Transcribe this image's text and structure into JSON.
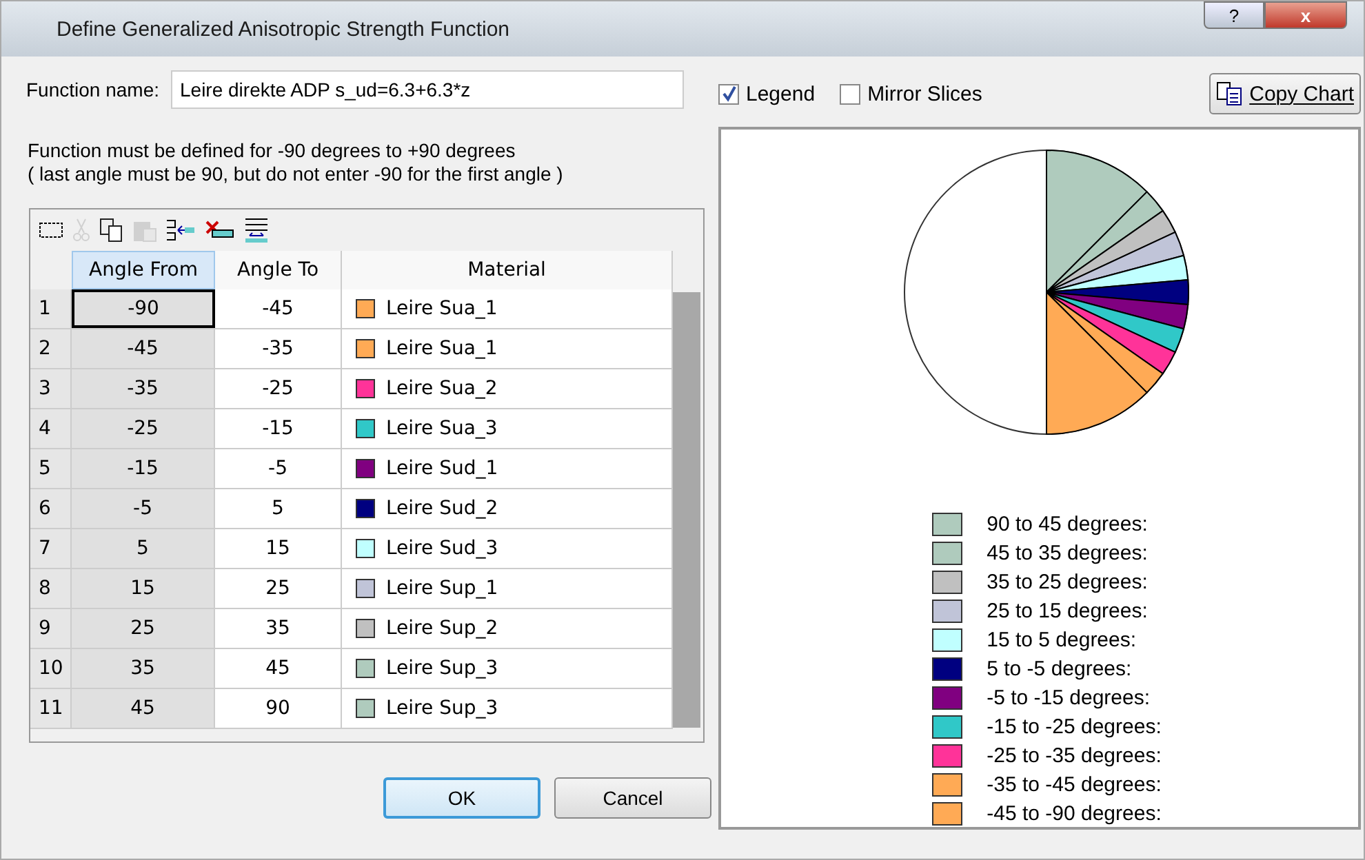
{
  "window": {
    "title": "Define Generalized Anisotropic Strength Function",
    "buttons": [
      "?",
      "x"
    ]
  },
  "function_name": {
    "label": "Function name:",
    "value": "Leire direkte ADP s_ud=6.3+6.3*z"
  },
  "note": [
    "Function must be defined for -90 degrees to +90 degrees",
    "( last angle must be 90, but do not enter -90 for the first angle )"
  ],
  "toolbar": [
    {
      "kind": "select",
      "disabled": false
    },
    {
      "kind": "cut",
      "disabled": true
    },
    {
      "kind": "copy",
      "disabled": false
    },
    {
      "kind": "paste",
      "disabled": true
    },
    {
      "kind": "insert",
      "disabled": false
    },
    {
      "kind": "delete",
      "disabled": false
    },
    {
      "kind": "append",
      "disabled": false
    }
  ],
  "table": {
    "columns": [
      {
        "label": "Angle From",
        "selected": true
      },
      {
        "label": "Angle To",
        "selected": false
      },
      {
        "label": "Material",
        "selected": false
      }
    ],
    "rows": [
      {
        "number": "1",
        "angle_from": "-90",
        "angle_to": "-45",
        "material": "Leire Sua_1",
        "color": "#ffaa55",
        "selected": true
      },
      {
        "number": "2",
        "angle_from": "-45",
        "angle_to": "-35",
        "material": "Leire Sua_1",
        "color": "#ffaa55",
        "selected": false
      },
      {
        "number": "3",
        "angle_from": "-35",
        "angle_to": "-25",
        "material": "Leire Sua_2",
        "color": "#ff3399",
        "selected": false
      },
      {
        "number": "4",
        "angle_from": "-25",
        "angle_to": "-15",
        "material": "Leire Sua_3",
        "color": "#30c8c8",
        "selected": false
      },
      {
        "number": "5",
        "angle_from": "-15",
        "angle_to": "-5",
        "material": "Leire Sud_1",
        "color": "#800080",
        "selected": false
      },
      {
        "number": "6",
        "angle_from": "-5",
        "angle_to": "5",
        "material": "Leire Sud_2",
        "color": "#000080",
        "selected": false
      },
      {
        "number": "7",
        "angle_from": "5",
        "angle_to": "15",
        "material": "Leire Sud_3",
        "color": "#c0ffff",
        "selected": false
      },
      {
        "number": "8",
        "angle_from": "15",
        "angle_to": "25",
        "material": "Leire Sup_1",
        "color": "#c0c4d8",
        "selected": false
      },
      {
        "number": "9",
        "angle_from": "25",
        "angle_to": "35",
        "material": "Leire Sup_2",
        "color": "#c0c0c0",
        "selected": false
      },
      {
        "number": "10",
        "angle_from": "35",
        "angle_to": "45",
        "material": "Leire Sup_3",
        "color": "#afcbbd",
        "selected": false
      },
      {
        "number": "11",
        "angle_from": "45",
        "angle_to": "90",
        "material": "Leire Sup_3",
        "color": "#afcbbd",
        "selected": false
      }
    ]
  },
  "buttons": [
    {
      "label": "OK",
      "default": true
    },
    {
      "label": "Cancel",
      "default": false
    }
  ],
  "options": [
    {
      "label": "Legend",
      "checked": true
    },
    {
      "label": "Mirror Slices",
      "checked": false
    }
  ],
  "copy_button": {
    "label": "Copy Chart"
  },
  "chart": {
    "label_suffix": ":",
    "legend": [
      {
        "color": "#afcbbd"
      },
      {
        "color": "#afcbbd"
      },
      {
        "color": "#c0c0c0"
      },
      {
        "color": "#c0c4d8"
      },
      {
        "color": "#c0ffff"
      },
      {
        "color": "#000080"
      },
      {
        "color": "#800080"
      },
      {
        "color": "#30c8c8"
      },
      {
        "color": "#ff3399"
      },
      {
        "color": "#ffaa55"
      },
      {
        "color": "#ffaa55"
      }
    ],
    "chart_data": {
      "type": "pie",
      "categories": [
        "90 to 45 degrees",
        "45 to 35 degrees",
        "35 to 25 degrees",
        "25 to 15 degrees",
        "15 to 5 degrees",
        "5 to -5 degrees",
        "-5 to -15 degrees",
        "-15 to -25 degrees",
        "-25 to -35 degrees",
        "-35 to -45 degrees",
        "-45 to -90 degrees"
      ],
      "values": [
        45,
        10,
        10,
        10,
        10,
        10,
        10,
        10,
        10,
        10,
        45
      ]
    }
  }
}
